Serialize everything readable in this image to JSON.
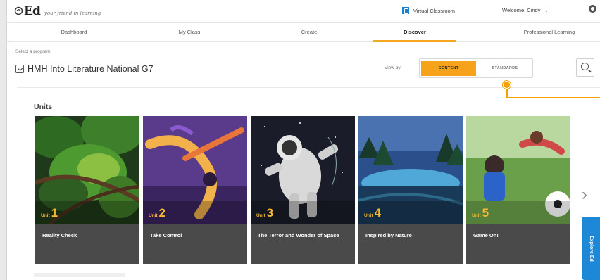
{
  "header": {
    "logo": "Ed",
    "tagline": "your friend in learning",
    "virtual_classroom": "Virtual Classroom",
    "welcome": "Welcome, Cindy"
  },
  "nav": {
    "items": [
      {
        "label": "Dashboard"
      },
      {
        "label": "My Class"
      },
      {
        "label": "Create"
      },
      {
        "label": "Discover"
      },
      {
        "label": "Professional Learning"
      }
    ],
    "active": "Discover"
  },
  "program": {
    "label": "Select a program",
    "name": "HMH Into Literature National G7"
  },
  "view_by": {
    "label": "View by",
    "options": [
      "CONTENT",
      "STANDARDS"
    ],
    "selected": "CONTENT"
  },
  "units": {
    "heading": "Units",
    "unit_word": "Unit",
    "items": [
      {
        "number": "1",
        "title": "Reality Check"
      },
      {
        "number": "2",
        "title": "Take Control"
      },
      {
        "number": "3",
        "title": "The Terror and Wonder of Space"
      },
      {
        "number": "4",
        "title": "Inspired by Nature"
      },
      {
        "number": "5",
        "title": "Game On!"
      }
    ]
  },
  "explore_tab": "Explore Ed",
  "colors": {
    "accent": "#f7a21b",
    "explore_blue": "#1e88d8",
    "caption_bg": "#4a4a4a"
  }
}
